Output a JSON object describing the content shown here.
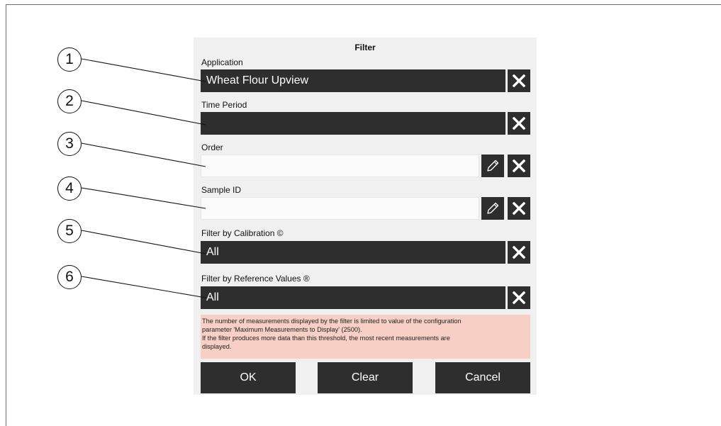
{
  "dialog": {
    "title": "Filter"
  },
  "fields": [
    {
      "label": "Application",
      "value": "Wheat Flour Upview"
    },
    {
      "label": "Time Period",
      "value": ""
    },
    {
      "label": "Order",
      "value": ""
    },
    {
      "label": "Sample ID",
      "value": ""
    },
    {
      "label": "Filter by Calibration ©",
      "value": "All"
    },
    {
      "label": "Filter by Reference Values ®",
      "value": "All"
    }
  ],
  "notice": {
    "lines": [
      "The number of measurements displayed by the filter is limited to value of the configuration",
      "parameter 'Maximum Measurements to Display' (2500).",
      "If the filter produces more data than this threshold, the most recent measurements are",
      "displayed."
    ]
  },
  "buttons": {
    "ok": "OK",
    "clear": "Clear",
    "cancel": "Cancel"
  },
  "callouts": [
    "1",
    "2",
    "3",
    "4",
    "5",
    "6"
  ],
  "icons": {
    "clear": "close-icon",
    "edit": "pencil-icon"
  },
  "colors": {
    "field_dark": "#2e2e2e",
    "notice_bg": "#f7cfc4",
    "panel_bg": "#f0f0f0"
  }
}
